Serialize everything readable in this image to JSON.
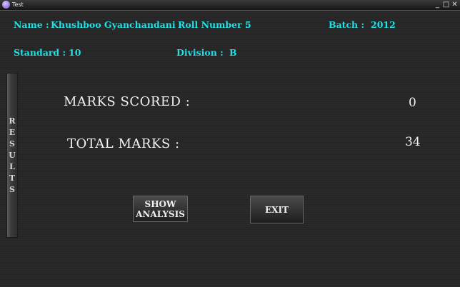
{
  "window": {
    "title": "Test",
    "minimize": "_",
    "maximize": "□",
    "close": "✕",
    "icon": "app-icon"
  },
  "student": {
    "name_label": "Name :",
    "name_value": "Khushboo Gyanchandani",
    "roll_label": "Roll Number :",
    "roll_value": "5",
    "batch_label": "Batch :",
    "batch_value": "2012",
    "standard_label": "Standard :",
    "standard_value": "10",
    "division_label": "Division :",
    "division_value": "B"
  },
  "results_panel": {
    "letters": [
      "R",
      "E",
      "S",
      "U",
      "L",
      "T",
      "S"
    ]
  },
  "scores": {
    "marks_scored_label": "MARKS SCORED :",
    "marks_scored_value": "0",
    "total_marks_label": "TOTAL MARKS :",
    "total_marks_value": "34"
  },
  "buttons": {
    "show_analysis_line1": "SHOW",
    "show_analysis_line2": "ANALYSIS",
    "exit": "EXIT"
  },
  "colors": {
    "info_text": "#21e0e6",
    "background": "#262626"
  }
}
